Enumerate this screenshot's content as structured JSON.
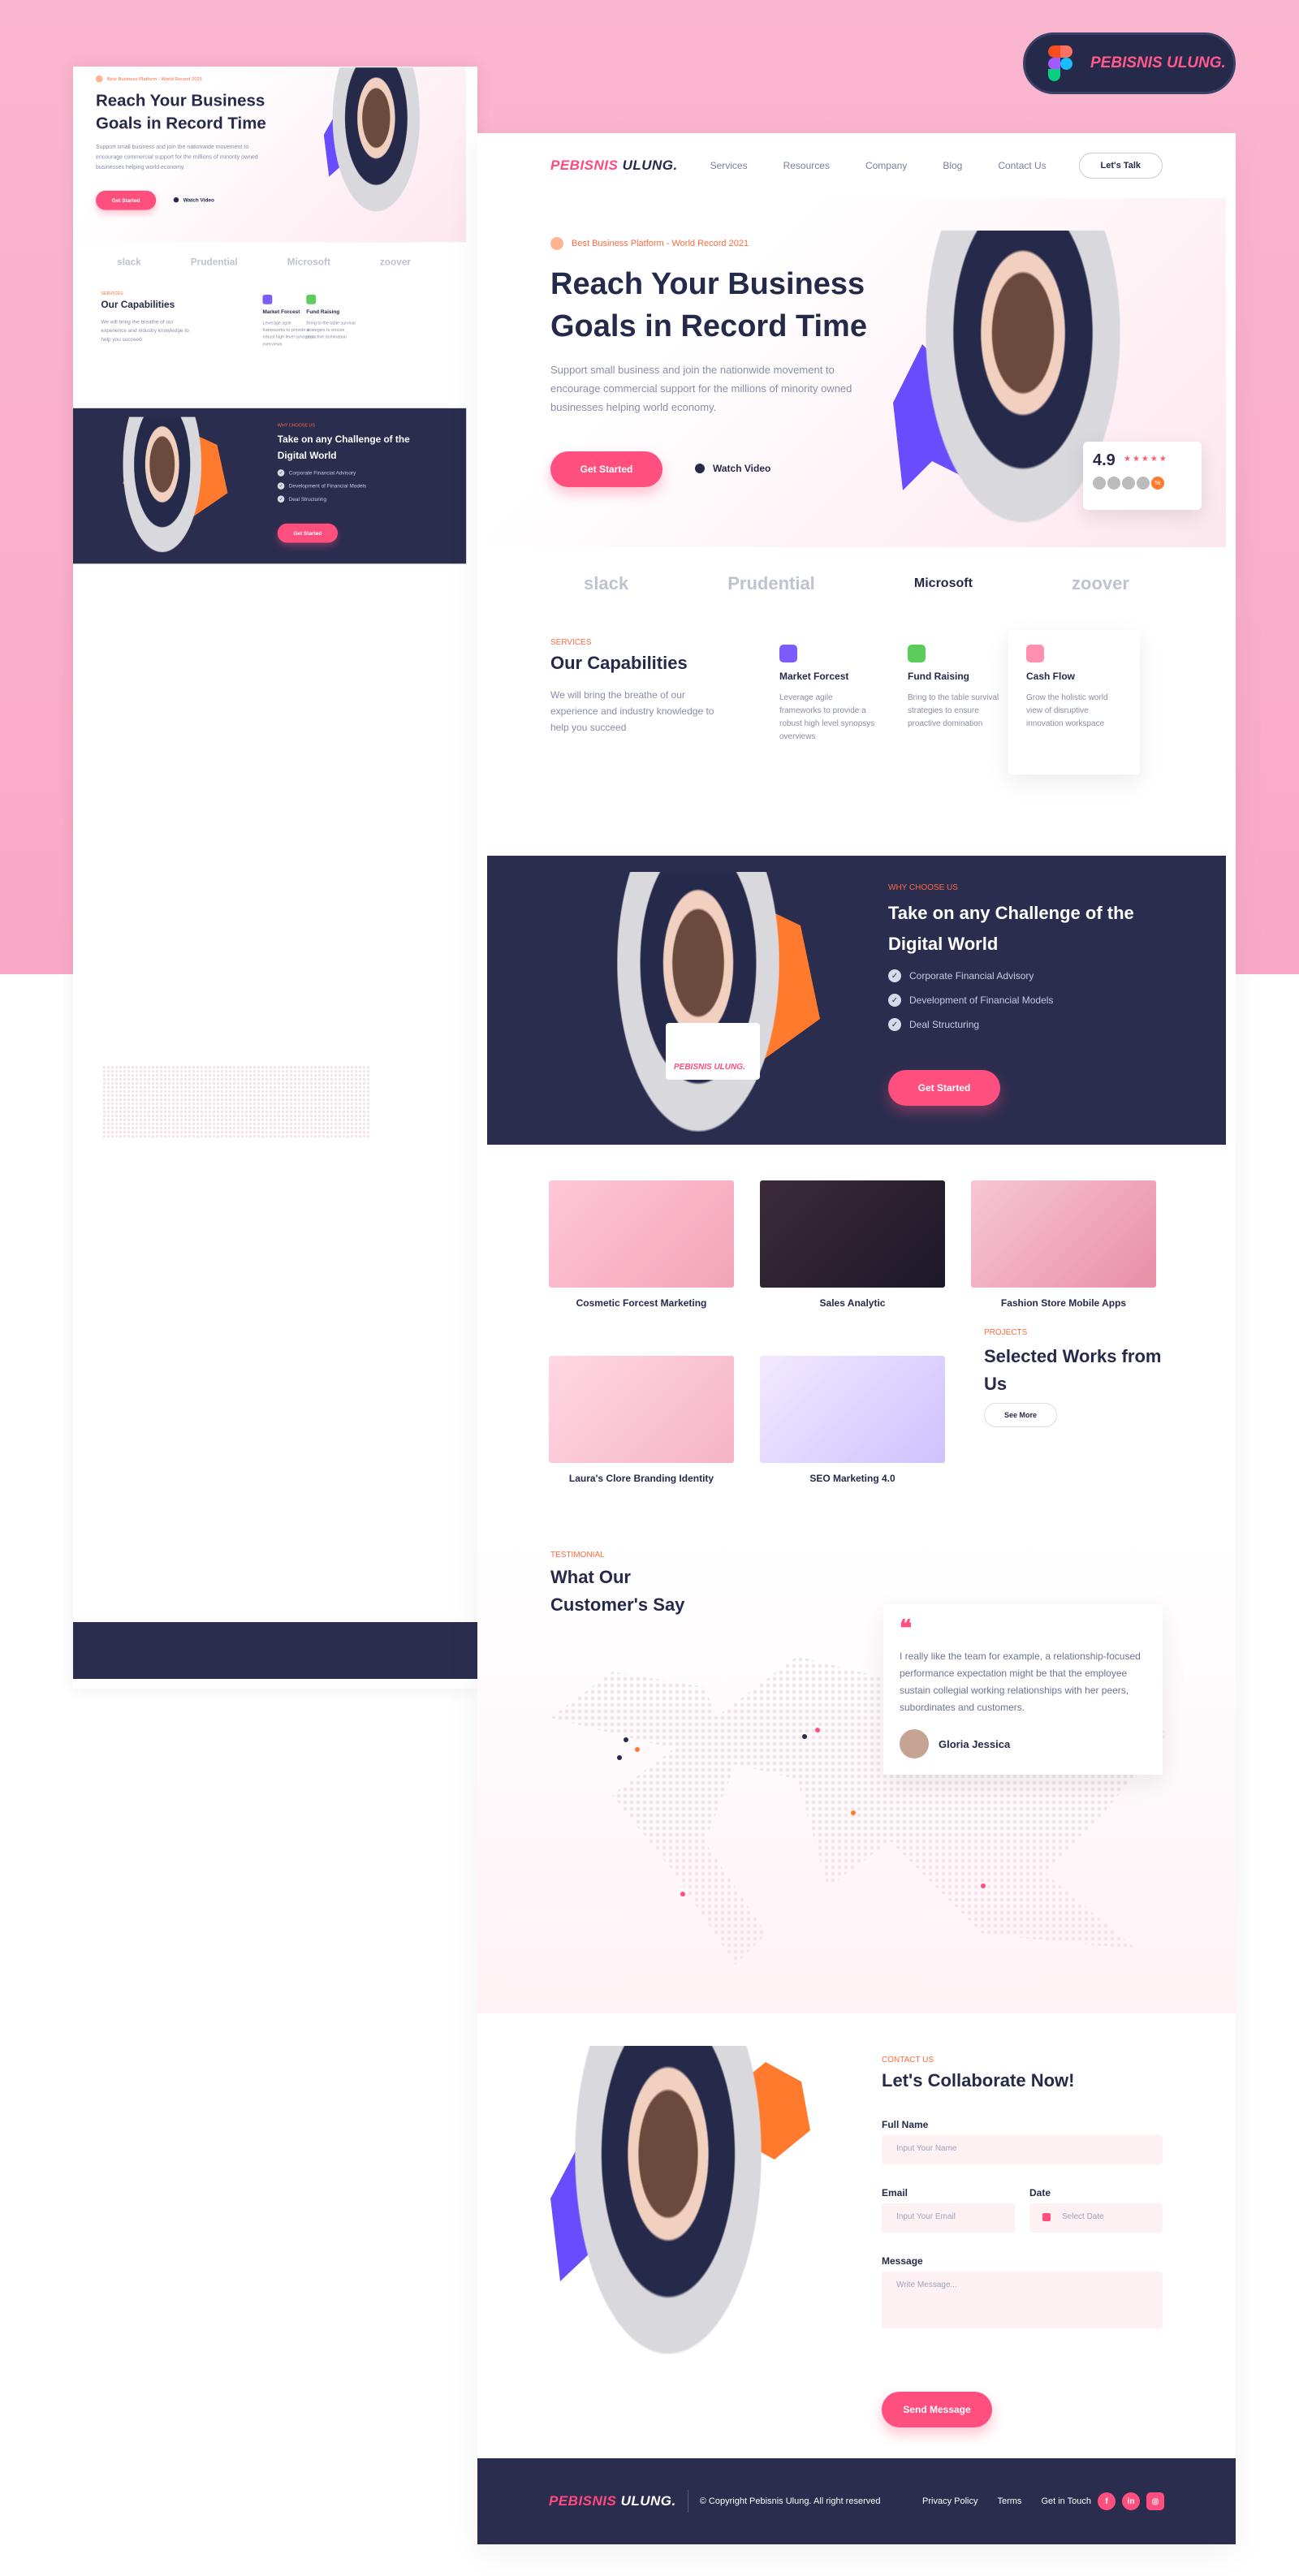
{
  "figma_badge": {
    "label": "PEBISNIS ULUNG."
  },
  "nav": {
    "logo_pink": "PEBISNIS",
    "logo_dark": "ULUNG.",
    "links": [
      "Services",
      "Resources",
      "Company",
      "Blog",
      "Contact Us"
    ],
    "cta": "Let's Talk"
  },
  "hero": {
    "tag": "Best Business Platform - World Record 2021",
    "title": "Reach Your Business Goals in Record Time",
    "text": "Support small business and join the nationwide movement to encourage commercial support for the millions of minority owned businesses helping world economy.",
    "primary": "Get Started",
    "secondary": "Watch Video",
    "rating": "4.9",
    "stars": "★★★★★",
    "more": "5k"
  },
  "brands": [
    "slack",
    "Prudential",
    "Microsoft",
    "zoover"
  ],
  "capabilities": {
    "label": "Services",
    "title": "Our Capabilities",
    "text": "We will bring the breathe of our experience and industry knowledge to help you succeed",
    "items": [
      {
        "title": "Market Forcest",
        "text": "Leverage agile frameworks to provide a robust high level synopsys overviews"
      },
      {
        "title": "Fund Raising",
        "text": "Bring to the table survival strategies to ensure proactive domination"
      },
      {
        "title": "Cash Flow",
        "text": "Grow the holistic world view of disruptive innovation workspace"
      }
    ]
  },
  "why": {
    "label": "Why Choose Us",
    "title": "Take on any Challenge of the Digital World",
    "items": [
      "Corporate Financial Advisory",
      "Development of Financial Models",
      "Deal Structuring"
    ],
    "cta": "Get Started",
    "laptop_logo": "PEBISNIS ULUNG."
  },
  "works": {
    "items": [
      "Cosmetic Forcest Marketing",
      "Sales Analytic",
      "Fashion Store Mobile Apps",
      "Laura's Clore Branding Identity",
      "SEO Marketing 4.0"
    ],
    "label": "Projects",
    "title": "Selected Works from Us",
    "cta": "See More"
  },
  "testimonial": {
    "label": "Testimonial",
    "title": "What Our Customer's Say",
    "quote_mark": "❝",
    "quote": "I really like the team for example, a relationship-focused performance expectation might be that the employee sustain collegial working relationships with her peers, subordinates and customers.",
    "name": "Gloria Jessica"
  },
  "contact": {
    "label": "Contact Us",
    "title": "Let's Collaborate Now!",
    "full_name_label": "Full Name",
    "full_name_ph": "Input Your Name",
    "email_label": "Email",
    "email_ph": "Input Your Email",
    "date_label": "Date",
    "date_ph": "Select Date",
    "message_label": "Message",
    "message_ph": "Write Message...",
    "send": "Send Message"
  },
  "footer": {
    "copyright": "© Copyright Pebisnis Ulung. All right reserved",
    "links": [
      "Privacy Policy",
      "Terms"
    ],
    "get_in_touch": "Get in Touch",
    "social": [
      "f",
      "in",
      "◎"
    ]
  },
  "colors": {
    "pink": "#ff4f7f",
    "navy": "#2b2d4f",
    "orange": "#ff7a2d",
    "purple": "#6a4cff",
    "bg_pink": "#fbb6cf"
  }
}
